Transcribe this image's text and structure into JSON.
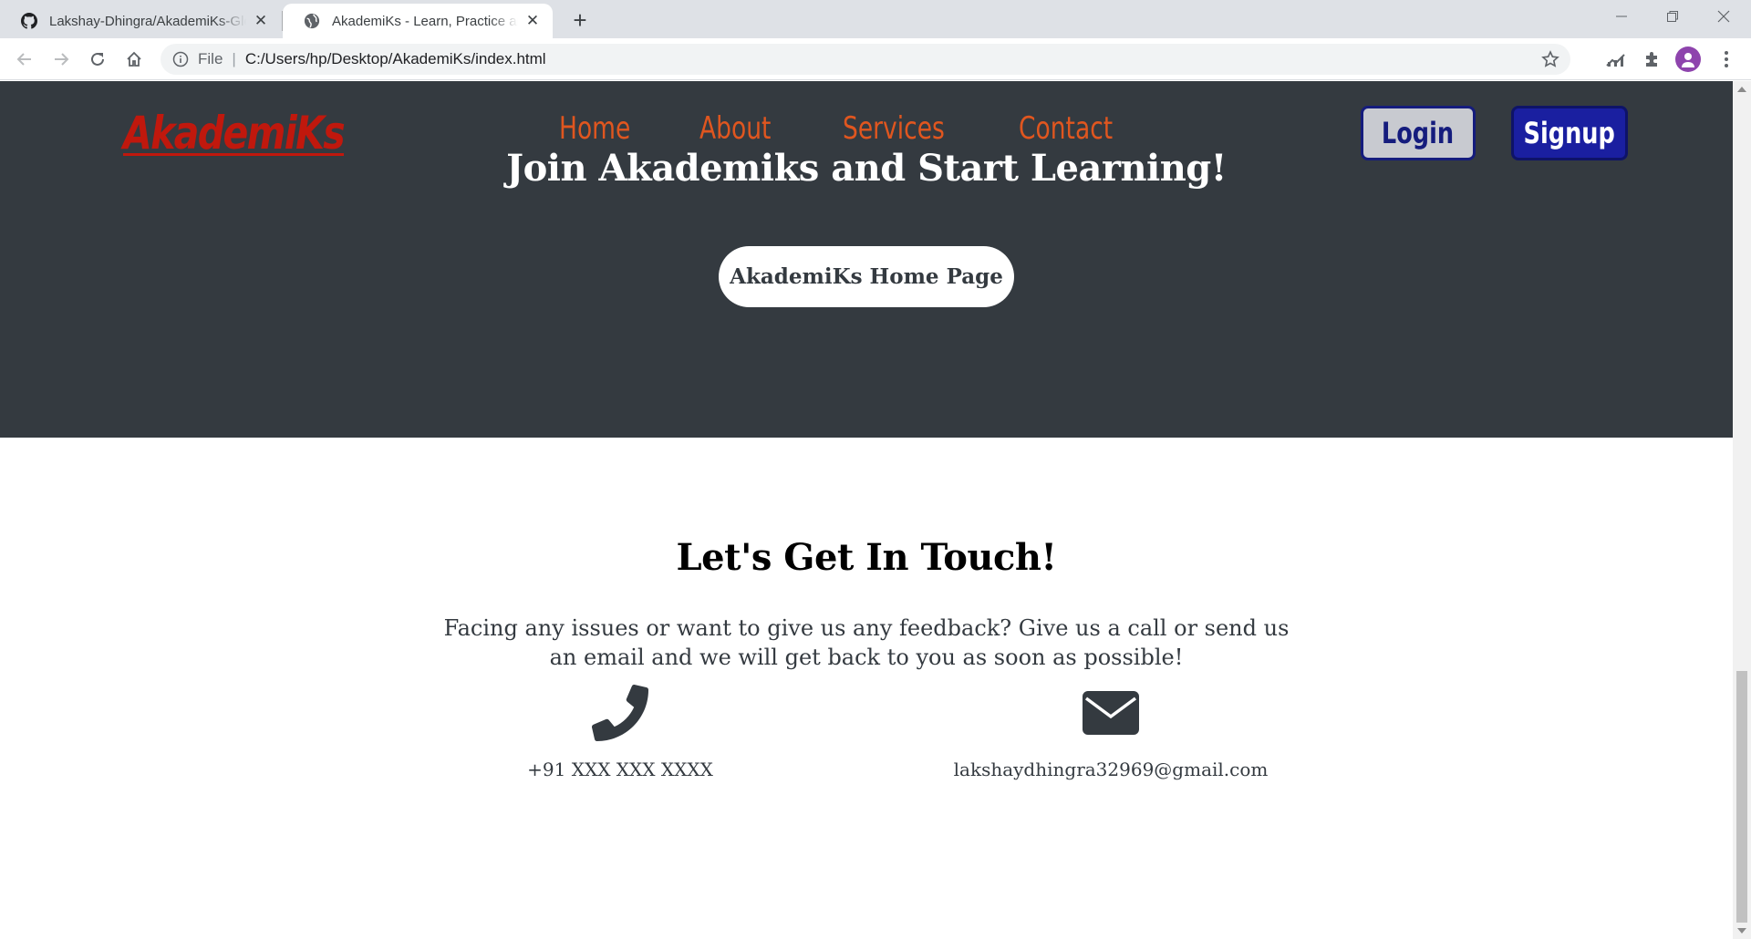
{
  "browser": {
    "tabs": [
      {
        "title": "Lakshay-Dhingra/AkademiKs-Glo",
        "icon": "github-icon",
        "active": false
      },
      {
        "title": "AkademiKs - Learn, Practice and E",
        "icon": "globe-icon",
        "active": true
      }
    ],
    "new_tab_label": "+",
    "address": {
      "scheme": "File",
      "url": "C:/Users/hp/Desktop/AkademiKs/index.html"
    }
  },
  "page": {
    "logo": "AkademiKs",
    "nav": [
      "Home",
      "About",
      "Services",
      "Contact"
    ],
    "login_label": "Login",
    "signup_label": "Signup",
    "hero_title": "Join Akademiks and Start Learning!",
    "hero_button": "AkademiKs Home Page",
    "contact": {
      "title": "Let's Get In Touch!",
      "description": "Facing any issues or want to give us any feedback? Give us a call or send us an email and we will get back to you as soon as possible!",
      "phone": "+91 XXX XXX XXXX",
      "email": "lakshaydhingra32969@gmail.com"
    }
  },
  "colors": {
    "hero_bg": "#343a40",
    "logo": "#c0180d",
    "nav_link": "#e0561f",
    "signup_bg": "#1a1fa0",
    "login_bg": "#c8cad0"
  }
}
